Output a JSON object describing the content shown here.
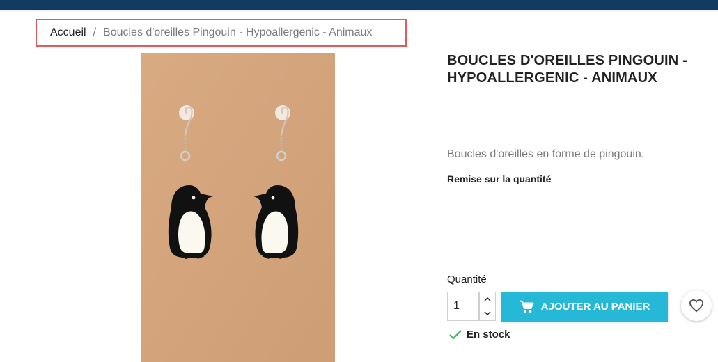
{
  "breadcrumb": {
    "home": "Accueil",
    "separator": "/",
    "current": "Boucles d'oreilles Pingouin - Hypoallergenic - Animaux"
  },
  "product": {
    "title": "BOUCLES D'OREILLES PINGOUIN - HYPOALLERGENIC - ANIMAUX",
    "short_description": "Boucles d'oreilles en forme de pingouin.",
    "discount_label": "Remise sur la quantité",
    "image_icon": "penguin-earrings-photo"
  },
  "purchase": {
    "quantity_label": "Quantité",
    "quantity_value": "1",
    "add_to_cart_label": "AJOUTER AU PANIER",
    "stock_label": "En stock"
  },
  "icons": {
    "cart": "shopping-cart-icon",
    "wishlist": "heart-icon",
    "stock": "check-icon",
    "up": "chevron-up-icon",
    "down": "chevron-down-icon"
  },
  "colors": {
    "topbar": "#123b62",
    "accent": "#25b9d7",
    "highlight_border": "#e05b5b",
    "stock_check": "#4cbb6c",
    "image_background": "#d4a47c"
  }
}
